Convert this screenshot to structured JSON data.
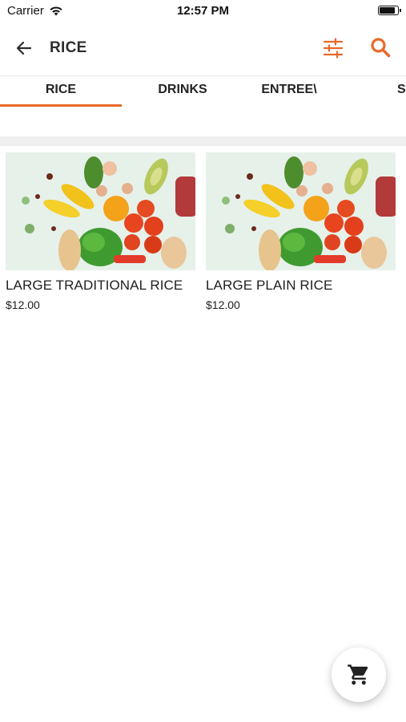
{
  "status_bar": {
    "carrier": "Carrier",
    "time": "12:57 PM",
    "battery_level": 1.0
  },
  "header": {
    "title": "RICE",
    "back_icon": "arrow-left-icon",
    "filter_icon": "sliders-icon",
    "search_icon": "search-icon"
  },
  "tabs": [
    {
      "label": "RICE",
      "active": true
    },
    {
      "label": "DRINKS",
      "active": false
    },
    {
      "label": "ENTREE\\",
      "active": false
    },
    {
      "label": "S",
      "active": false
    }
  ],
  "products": [
    {
      "name": "LARGE TRADITIONAL RICE",
      "price": "$12.00",
      "image": "vegetables-photo"
    },
    {
      "name": "LARGE PLAIN RICE",
      "price": "$12.00",
      "image": "vegetables-photo"
    }
  ],
  "cart": {
    "icon": "cart-icon"
  },
  "colors": {
    "accent": "#e8692a",
    "text": "#1f1f1f",
    "band": "#efefef"
  }
}
